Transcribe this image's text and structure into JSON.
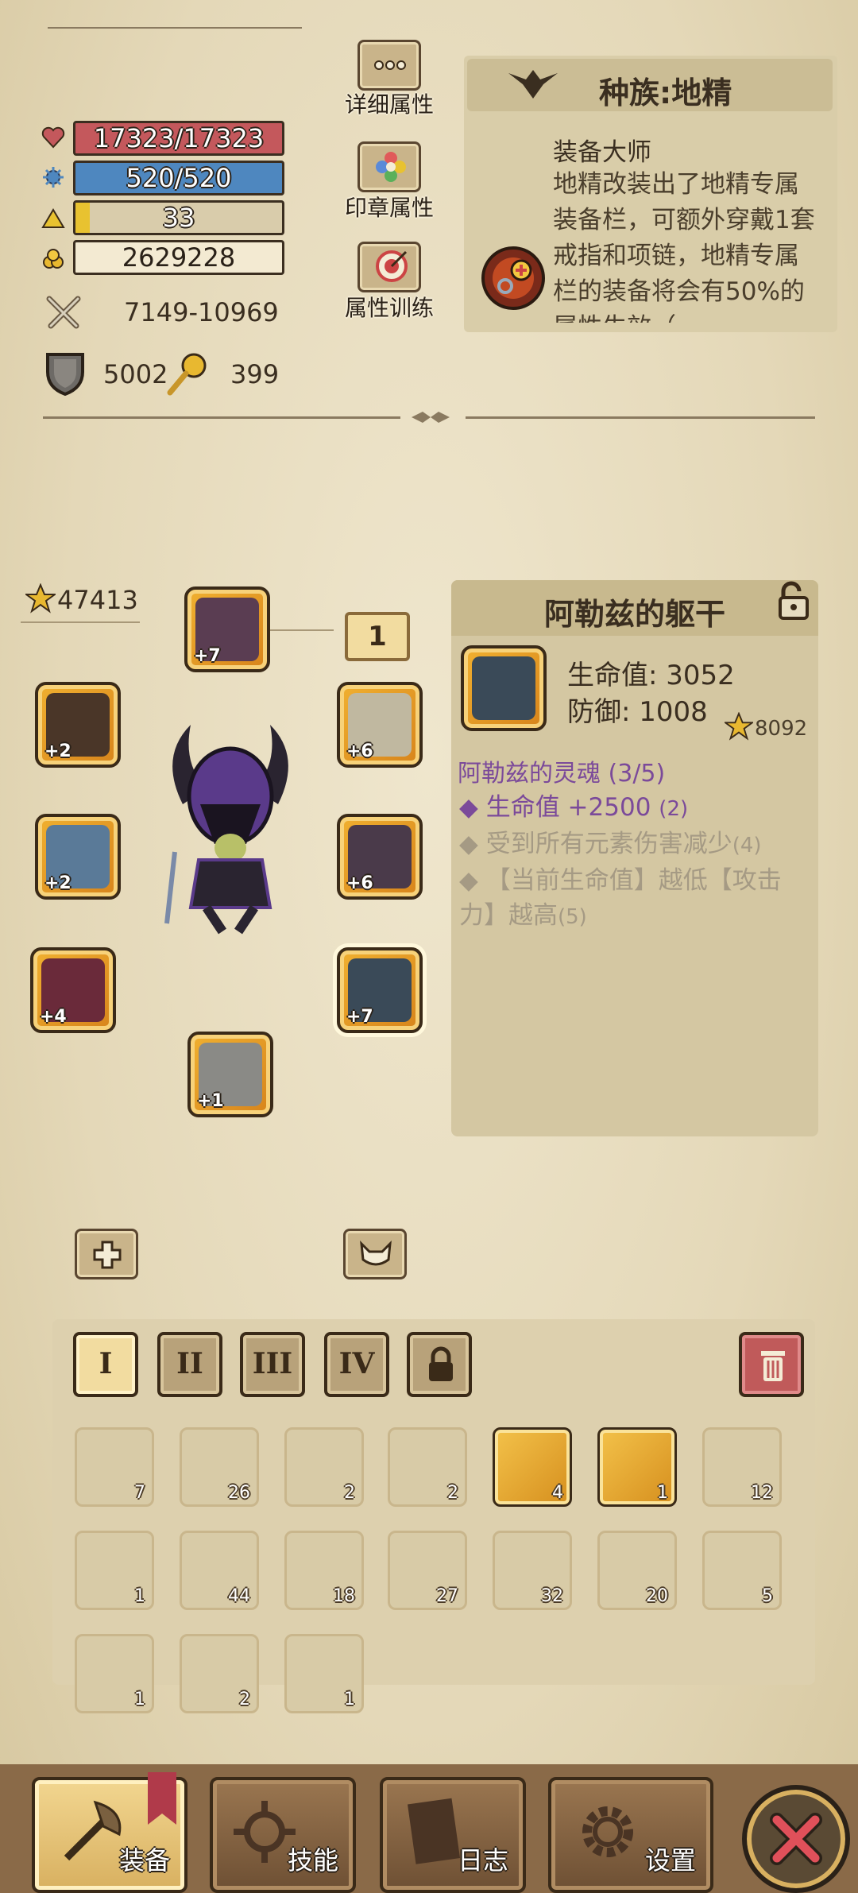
{
  "stats": {
    "hp": "17323/17323",
    "mana": "520/520",
    "level": "33",
    "gold": "2629228",
    "attack": "7149-10969",
    "defense": "5002",
    "luck": "399",
    "exp_fill": 0.07
  },
  "side_buttons": {
    "detail": "详细属性",
    "seal": "印章属性",
    "training": "属性训练"
  },
  "race": {
    "title": "种族:地精",
    "skill_name": "装备大师",
    "skill_desc": "地精改装出了地精专属装备栏，可额外穿戴1套戒指和项链，地精专属栏的装备将会有50%的属性生效（"
  },
  "equipment": {
    "power": "47413",
    "set_index": "1",
    "slots": [
      {
        "lvl": "+7"
      },
      {
        "lvl": "+2"
      },
      {
        "lvl": "+2"
      },
      {
        "lvl": "+4"
      },
      {
        "lvl": "+1"
      },
      {
        "lvl": "+6"
      },
      {
        "lvl": "+6"
      },
      {
        "lvl": "+7"
      }
    ]
  },
  "item_detail": {
    "name": "阿勒兹的躯干",
    "hp": "生命值: 3052",
    "def": "防御: 1008",
    "score": "8092",
    "set_name": "阿勒兹的灵魂 (3/5)",
    "bonuses": [
      {
        "text": "生命值 +2500",
        "req": "(2)"
      },
      {
        "text": "受到所有元素伤害减少",
        "req": "(4)"
      },
      {
        "text": "【当前生命值】越低【攻击力】越高",
        "req": "(5)"
      }
    ]
  },
  "bag_tabs": [
    "I",
    "II",
    "III",
    "IV"
  ],
  "inventory": [
    {
      "icon": "pickaxe-icon",
      "count": "7"
    },
    {
      "icon": "eye-map-icon",
      "count": "26"
    },
    {
      "icon": "red-potion-icon",
      "count": "2"
    },
    {
      "icon": "red-flask-icon",
      "count": "2"
    },
    {
      "icon": "yellow-potion-icon",
      "count": "4"
    },
    {
      "icon": "star-potion-icon",
      "count": "1"
    },
    {
      "icon": "fire-flask-icon",
      "count": "12"
    },
    {
      "icon": "star-wand-icon",
      "count": "1"
    },
    {
      "icon": "anvil-icon",
      "count": "44"
    },
    {
      "icon": "chest-icon",
      "count": "18"
    },
    {
      "icon": "shovel-icon",
      "count": "27"
    },
    {
      "icon": "meat-icon",
      "count": "32"
    },
    {
      "icon": "log-icon",
      "count": "20"
    },
    {
      "icon": "saw-icon",
      "count": "5"
    },
    {
      "icon": "pouch-icon",
      "count": "1"
    },
    {
      "icon": "wood-icon",
      "count": "2"
    },
    {
      "icon": "doll-icon",
      "count": "1"
    }
  ],
  "nav": {
    "equip": "装备",
    "skill": "技能",
    "log": "日志",
    "settings": "设置"
  },
  "colors": {
    "hp": "#c4585c",
    "mana": "#4e87bf",
    "level": "#e8c230",
    "paper": "#e6dcc0",
    "set": "#7b4a9a",
    "frame": "#f0b030"
  }
}
